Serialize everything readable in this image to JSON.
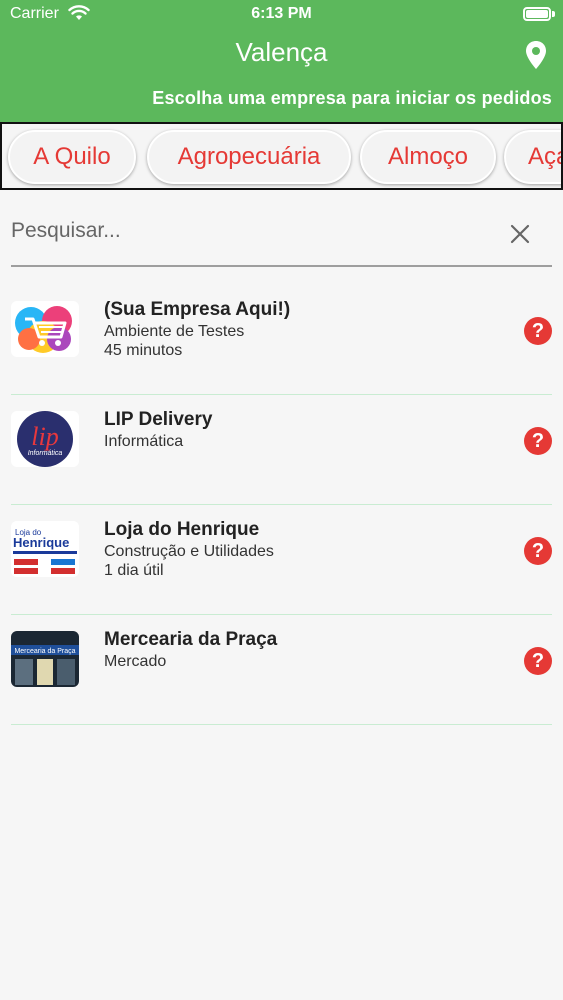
{
  "status_bar": {
    "carrier": "Carrier",
    "time": "6:13 PM"
  },
  "header": {
    "city": "Valença",
    "subtitle": "Escolha uma empresa para iniciar os pedidos",
    "pin_icon": "map-pin-icon",
    "accent_color": "#5cb85c"
  },
  "categories": [
    "A Quilo",
    "Agropecuária",
    "Almoço",
    "Açaí"
  ],
  "search": {
    "placeholder": "Pesquisar...",
    "value": ""
  },
  "companies": [
    {
      "name": "(Sua Empresa Aqui!)",
      "category": "Ambiente de Testes",
      "delivery": "45 minutos",
      "logo_icon": "shopping-cart-logo"
    },
    {
      "name": "LIP Delivery",
      "category": "Informática",
      "delivery": "",
      "logo_icon": "lip-logo"
    },
    {
      "name": "Loja do Henrique",
      "category": "Construção e Utilidades",
      "delivery": "1 dia útil",
      "logo_icon": "henrique-logo",
      "logo_text": "Loja do Henrique"
    },
    {
      "name": "Mercearia da Praça",
      "category": "Mercado",
      "delivery": "",
      "logo_icon": "storefront-photo",
      "logo_text": "Mercearia da Praça"
    }
  ],
  "help_glyph": "?",
  "colors": {
    "chip_text": "#e53935",
    "help_badge": "#e53935",
    "divider": "#c9ecd2"
  }
}
